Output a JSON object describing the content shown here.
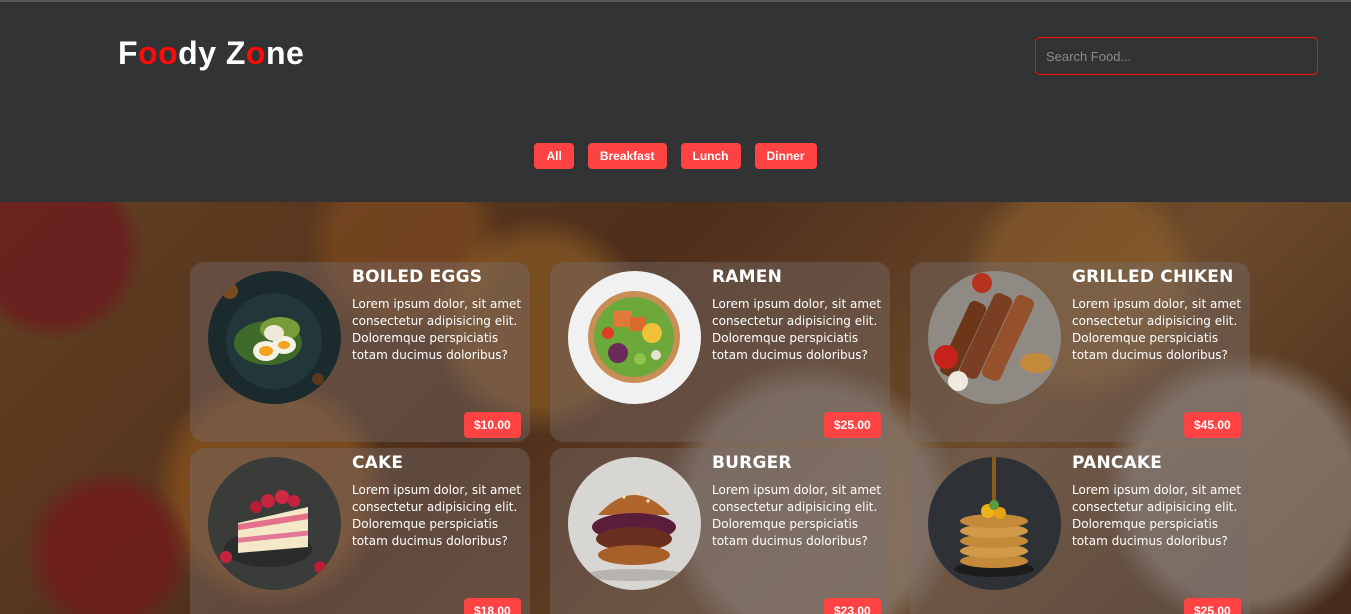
{
  "header": {
    "logo": {
      "part1": "F",
      "part2": "oo",
      "part3": "dy Z",
      "part4": "o",
      "part5": "ne"
    },
    "search": {
      "placeholder": "Search Food...",
      "value": ""
    }
  },
  "filters": [
    {
      "label": "All"
    },
    {
      "label": "Breakfast"
    },
    {
      "label": "Lunch"
    },
    {
      "label": "Dinner"
    }
  ],
  "foods": [
    {
      "name": "BOILED EGGS",
      "text": "Lorem ipsum dolor, sit amet consectetur adipisicing elit. Doloremque perspiciatis totam ducimus doloribus?",
      "price": "$10.00",
      "image": "boiled-eggs-image"
    },
    {
      "name": "RAMEN",
      "text": "Lorem ipsum dolor, sit amet consectetur adipisicing elit. Doloremque perspiciatis totam ducimus doloribus?",
      "price": "$25.00",
      "image": "ramen-image"
    },
    {
      "name": "GRILLED CHIKEN",
      "text": "Lorem ipsum dolor, sit amet consectetur adipisicing elit. Doloremque perspiciatis totam ducimus doloribus?",
      "price": "$45.00",
      "image": "grilled-chicken-image"
    },
    {
      "name": "CAKE",
      "text": "Lorem ipsum dolor, sit amet consectetur adipisicing elit. Doloremque perspiciatis totam ducimus doloribus?",
      "price": "$18.00",
      "image": "cake-image"
    },
    {
      "name": "BURGER",
      "text": "Lorem ipsum dolor, sit amet consectetur adipisicing elit. Doloremque perspiciatis totam ducimus doloribus?",
      "price": "$23.00",
      "image": "burger-image"
    },
    {
      "name": "PANCAKE",
      "text": "Lorem ipsum dolor, sit amet consectetur adipisicing elit. Doloremque perspiciatis totam ducimus doloribus?",
      "price": "$25.00",
      "image": "pancake-image"
    }
  ],
  "colors": {
    "accent": "#ff4343",
    "logo_red": "#ff0909",
    "header_bg": "#323334"
  }
}
